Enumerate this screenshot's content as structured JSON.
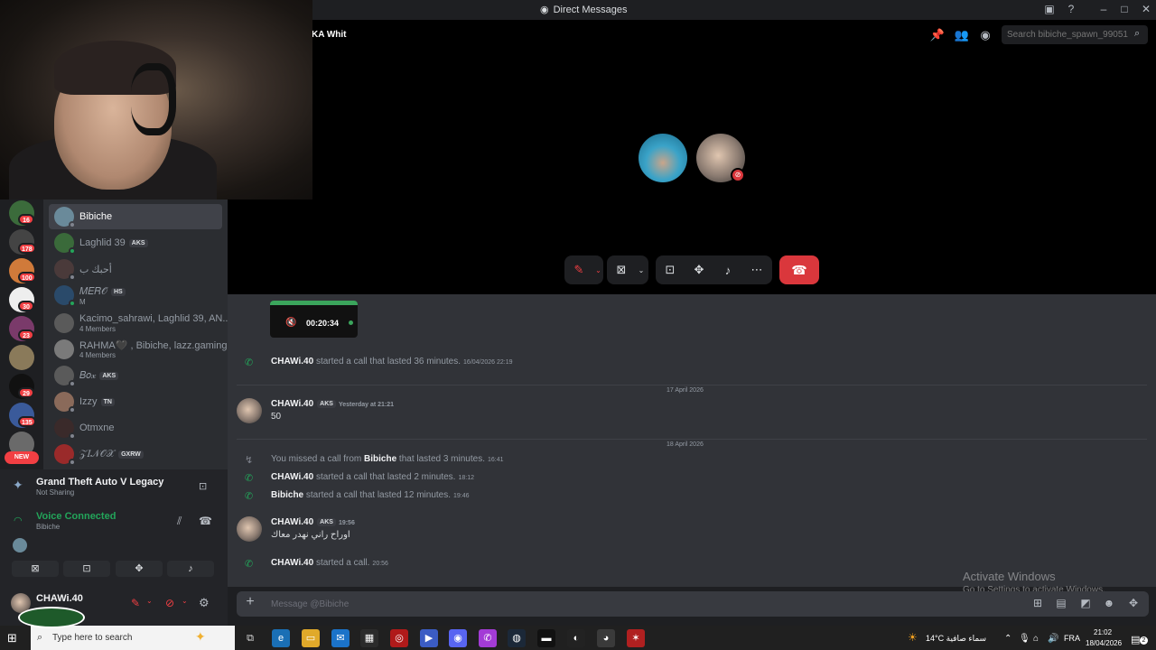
{
  "window": {
    "title": "Direct Messages",
    "controls": [
      "inbox-icon",
      "help-icon",
      "minimize-icon",
      "maximize-icon",
      "close-icon"
    ]
  },
  "header": {
    "names": "KA   Whit",
    "search_placeholder": "Search bibiche_spawn_99051"
  },
  "servers": {
    "badges": [
      "16",
      "178",
      "100",
      "30",
      "23",
      "29",
      "135"
    ],
    "new_label": "NEW"
  },
  "dms": [
    {
      "name": "Bibiche",
      "active": true
    },
    {
      "name": "Laghlid 39",
      "tag": "AKS"
    },
    {
      "name": "أحبك ب"
    },
    {
      "name": "𝑀𝐸𝑅𝒪",
      "tag": "HS",
      "sub": "M"
    },
    {
      "name": "Kacimo_sahrawi, Laghlid 39, AN...",
      "sub": "4 Members"
    },
    {
      "name": "RAHMA🖤 , Bibiche, lazz.gaming",
      "sub": "4 Members"
    },
    {
      "name": "𝐵𝑜𝓍",
      "tag": "AKS"
    },
    {
      "name": "Izzy",
      "tag": "TN"
    },
    {
      "name": "Otmxne"
    },
    {
      "name": "𝒵𝐼𝒩𝒪𝒳",
      "tag": "GXRW"
    }
  ],
  "activity": {
    "game": "Grand Theft Auto V Legacy",
    "game_status": "Not Sharing",
    "voice_status": "Voice Connected",
    "voice_channel": "Bibiche"
  },
  "user": {
    "name": "CHAWi.40"
  },
  "clip": {
    "time": "00:20:34"
  },
  "messages": {
    "call1": {
      "author": "CHAWi.40",
      "text": "started a call that lasted 36 minutes.",
      "time": "16/04/2026 22:19"
    },
    "date1": "17 April 2026",
    "msg1": {
      "author": "CHAWi.40",
      "tag": "AKS",
      "time": "Yesterday at 21:21",
      "text": "50"
    },
    "date2": "18 April 2026",
    "missed": {
      "prefix": "You missed a call from",
      "author": "Bibiche",
      "text": "that lasted 3 minutes.",
      "time": "16:41"
    },
    "call2": {
      "author": "CHAWi.40",
      "text": "started a call that lasted 2 minutes.",
      "time": "18:12"
    },
    "call3": {
      "author": "Bibiche",
      "text": "started a call that lasted 12 minutes.",
      "time": "19:46"
    },
    "msg2": {
      "author": "CHAWi.40",
      "tag": "AKS",
      "time": "19:56",
      "text": "اوراح راني نهدر معاك"
    },
    "call4": {
      "author": "CHAWi.40",
      "text": "started a call.",
      "time": "20:56"
    }
  },
  "composer": {
    "placeholder": "Message @Bibiche"
  },
  "watermark": {
    "title": "Activate Windows",
    "subtitle": "Go to Settings to activate Windows."
  },
  "taskbar": {
    "search_placeholder": "Type here to search",
    "weather": "14°C  سماء صافية",
    "lang": "FRA",
    "time": "21:02",
    "date": "18/04/2026",
    "notifications": "2"
  },
  "colors": {
    "accent_green": "#23a55a",
    "danger_red": "#da373c",
    "background": "#313338"
  }
}
